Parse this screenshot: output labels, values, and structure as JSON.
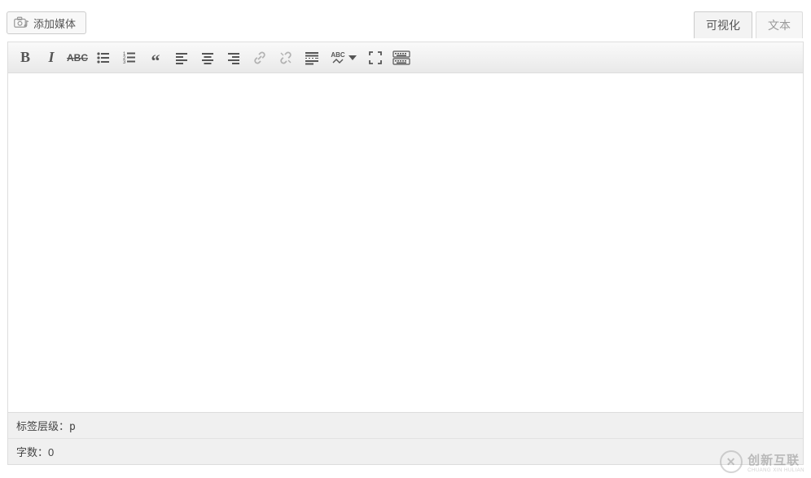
{
  "buttons": {
    "add_media": "添加媒体"
  },
  "tabs": {
    "visual": "可视化",
    "text": "文本"
  },
  "toolbar": {
    "bold": "B",
    "italic": "I",
    "strike": "ABC",
    "spellcheck": "ABC"
  },
  "toolbar_icons": [
    "bold",
    "italic",
    "strikethrough",
    "bullet-list",
    "numbered-list",
    "blockquote",
    "align-left",
    "align-center",
    "align-right",
    "link",
    "unlink",
    "insert-more",
    "spellcheck",
    "fullscreen",
    "keyboard-toggle"
  ],
  "status": {
    "path_label": "标签层级：",
    "path_value": "p",
    "wordcount_label": "字数：",
    "wordcount_value": "0"
  },
  "watermark": {
    "brand": "创新互联",
    "sub": "CHUANG XIN HULIAN",
    "mark": "Ⓧ"
  }
}
